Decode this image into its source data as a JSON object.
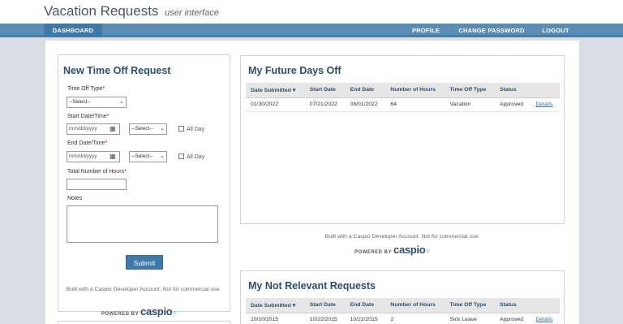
{
  "header": {
    "title": "Vacation Requests",
    "subtitle": "user interface"
  },
  "nav": {
    "dashboard": "DASHBOARD",
    "profile": "PROFILE",
    "change_password": "CHANGE PASSWORD",
    "logout": "LOGOUT"
  },
  "new_request": {
    "title": "New Time Off Request",
    "type_label": "Time Off Type",
    "required_mark": "*",
    "type_value": "--Select--",
    "start_label": "Start Date/Time",
    "start_date_placeholder": "mm/dd/yyyy",
    "start_time_value": "--Select--",
    "all_day": "All Day",
    "end_label": "End Date/Time",
    "end_date_placeholder": "mm/dd/yyyy",
    "end_time_value": "--Select--",
    "hours_label": "Total Number of Hours",
    "notes_label": "Notes",
    "submit": "Submit"
  },
  "footer": {
    "built_with": "Built with a Caspio Developer Account. Not for commercial use.",
    "powered_by": "POWERED BY",
    "brand": "caspio"
  },
  "future": {
    "title": "My Future Days Off",
    "columns": [
      "Date Submitted",
      "Start Date",
      "End Date",
      "Number of Hours",
      "Time Off Type",
      "Status",
      ""
    ],
    "rows": [
      [
        "01/30/2022",
        "07/21/2022",
        "08/01/2022",
        "64",
        "Vacation",
        "Approved",
        "Details"
      ]
    ]
  },
  "not_relevant": {
    "title": "My Not Relevant Requests",
    "columns": [
      "Date Submitted",
      "Start Date",
      "End Date",
      "Number of Hours",
      "Time Off Type",
      "Status",
      ""
    ],
    "rows": [
      [
        "10/10/2015",
        "10/22/2015",
        "10/22/2015",
        "2",
        "Sick Leave",
        "Approved",
        "Details"
      ]
    ]
  },
  "colors": {
    "nav": "#5a8db5",
    "accent": "#3f79a8",
    "title": "#2e4e6e"
  },
  "icons": {
    "calendar": "calendar-icon",
    "sort": "sort-desc-icon"
  }
}
